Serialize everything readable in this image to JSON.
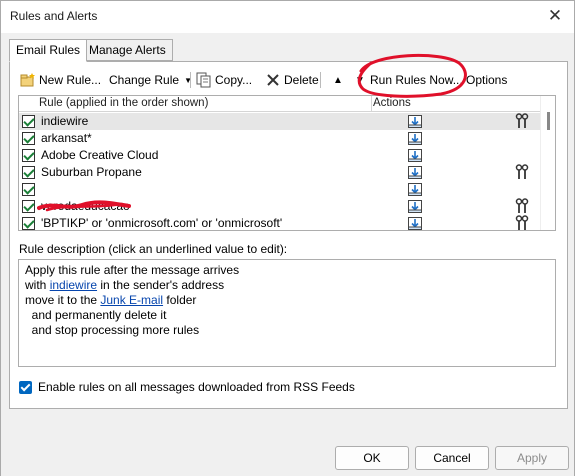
{
  "window": {
    "title": "Rules and Alerts",
    "close_glyph": "✕"
  },
  "tabs": [
    {
      "label": "Email Rules",
      "active": true
    },
    {
      "label": "Manage Alerts",
      "active": false
    }
  ],
  "toolbar": {
    "new_rule": "New Rule...",
    "change_rule": "Change Rule",
    "copy": "Copy...",
    "delete": "Delete",
    "run_rules_now": "Run Rules Now...",
    "options": "Options",
    "move_up_glyph": "▲",
    "move_down_glyph": "▼"
  },
  "table": {
    "col_rule": "Rule (applied in the order shown)",
    "col_actions": "Actions",
    "rows": [
      {
        "name": "indiewire",
        "checked": true,
        "selected": true,
        "has_wrench": true
      },
      {
        "name": "arkansat*",
        "checked": true,
        "selected": false,
        "has_wrench": false
      },
      {
        "name": "Adobe Creative Cloud",
        "checked": true,
        "selected": false,
        "has_wrench": false
      },
      {
        "name": "Suburban Propane",
        "checked": true,
        "selected": false,
        "has_wrench": true
      },
      {
        "name": "",
        "checked": true,
        "selected": false,
        "has_wrench": false,
        "redacted": true
      },
      {
        "name": "veredaeducacao",
        "checked": true,
        "selected": false,
        "has_wrench": true
      },
      {
        "name": "'BPTIKP' or 'onmicrosoft.com' or 'onmicrosoft'",
        "checked": true,
        "selected": false,
        "has_wrench": true
      }
    ]
  },
  "description": {
    "label": "Rule description (click an underlined value to edit):",
    "line1": "Apply this rule after the message arrives",
    "line2_pre": "with ",
    "line2_link": "indiewire",
    "line2_post": " in the sender's address",
    "line3_pre": "move it to the ",
    "line3_link": "Junk E-mail",
    "line3_post": " folder",
    "line4": "  and permanently delete it",
    "line5": "  and stop processing more rules"
  },
  "rss": {
    "label": "Enable rules on all messages downloaded from RSS Feeds",
    "checked": true
  },
  "buttons": {
    "ok": "OK",
    "cancel": "Cancel",
    "apply": "Apply"
  },
  "colors": {
    "accent": "#0067c0",
    "annotation_red": "#e0102a",
    "link": "#0645ad"
  }
}
